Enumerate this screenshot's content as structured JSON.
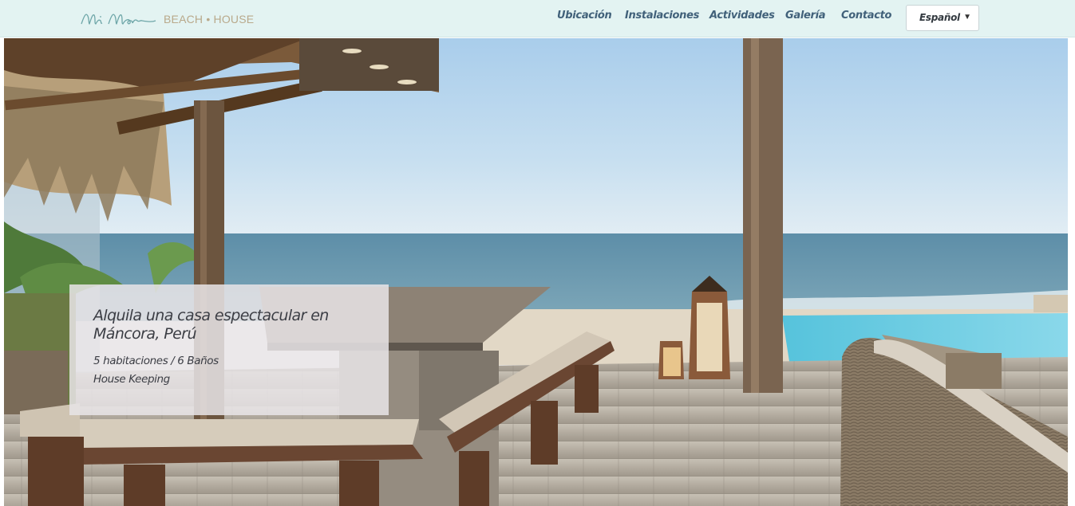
{
  "brand": {
    "script_name": "Mi Mar",
    "subtitle": "BEACH • HOUSE"
  },
  "nav": {
    "items": [
      {
        "label": "Ubicación"
      },
      {
        "label": "Instalaciones"
      },
      {
        "label": "Actividades"
      },
      {
        "label": "Galería"
      },
      {
        "label": "Contacto"
      }
    ]
  },
  "language": {
    "selected": "Español",
    "caret_icon": "caret-down-icon"
  },
  "hero": {
    "image": "beach-house-terrace-photo",
    "headline": "Alquila una casa espectacular en Máncora, Perú",
    "detail_1": "5 habitaciones / 6 Baños",
    "detail_2": "House Keeping"
  },
  "colors": {
    "topbar_bg": "#e3f3f2",
    "nav_text": "#41617a",
    "brand_sub": "#b9a98b",
    "logo_script": "#6ea6a8"
  }
}
